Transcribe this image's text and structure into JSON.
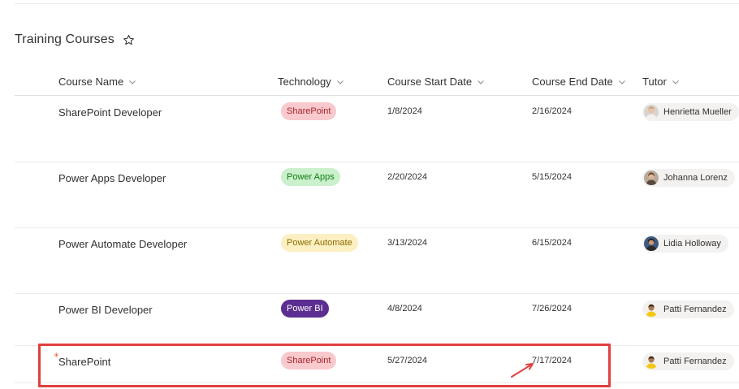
{
  "list": {
    "title": "Training Courses",
    "favorite_icon": "star-outline-icon"
  },
  "columns": [
    {
      "key": "course_name",
      "label": "Course Name"
    },
    {
      "key": "technology",
      "label": "Technology"
    },
    {
      "key": "start_date",
      "label": "Course Start Date"
    },
    {
      "key": "end_date",
      "label": "Course End Date"
    },
    {
      "key": "tutor",
      "label": "Tutor"
    }
  ],
  "tech_colors": {
    "SharePoint": {
      "bg": "#f8c9cd",
      "fg": "#a4262c"
    },
    "Power Apps": {
      "bg": "#caf0cc",
      "fg": "#107c10"
    },
    "Power Automate": {
      "bg": "#fcefc2",
      "fg": "#8a6d00"
    },
    "Power BI": {
      "bg": "#5c2e91",
      "fg": "#ffffff"
    }
  },
  "rows": [
    {
      "course_name": "SharePoint Developer",
      "technology": "SharePoint",
      "start_date": "1/8/2024",
      "end_date": "2/16/2024",
      "tutor": "Henrietta Mueller"
    },
    {
      "course_name": "Power Apps Developer",
      "technology": "Power Apps",
      "start_date": "2/20/2024",
      "end_date": "5/15/2024",
      "tutor": "Johanna Lorenz"
    },
    {
      "course_name": "Power Automate Developer",
      "technology": "Power Automate",
      "start_date": "3/13/2024",
      "end_date": "6/15/2024",
      "tutor": "Lidia Holloway"
    },
    {
      "course_name": "Power BI Developer",
      "technology": "Power BI",
      "start_date": "4/8/2024",
      "end_date": "7/26/2024",
      "tutor": "Patti Fernandez"
    },
    {
      "course_name": "SharePoint",
      "technology": "SharePoint",
      "start_date": "5/27/2024",
      "end_date": "7/17/2024",
      "tutor": "Patti Fernandez",
      "is_new": true
    }
  ],
  "annotation_color": "#e0403f"
}
